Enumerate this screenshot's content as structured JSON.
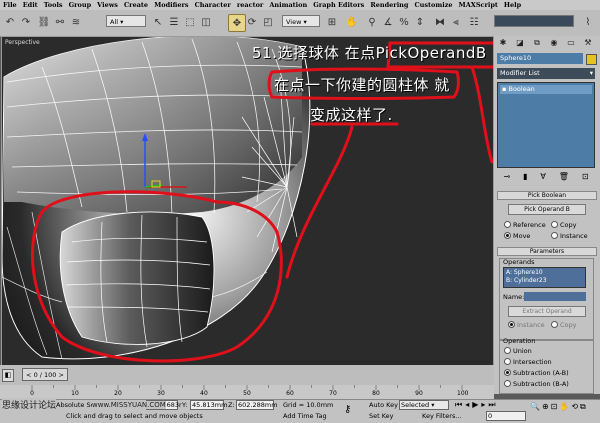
{
  "menu": [
    "File",
    "Edit",
    "Tools",
    "Group",
    "Views",
    "Create",
    "Modifiers",
    "Character",
    "reactor",
    "Animation",
    "Graph Editors",
    "Rendering",
    "Customize",
    "MAXScript",
    "Help"
  ],
  "toolbar": {
    "filter": "All",
    "coord": "View"
  },
  "viewport": {
    "label": "Perspective",
    "annotation": {
      "line1_prefix": "51.选择球体 在点",
      "line1_button": "PickOperandB",
      "line2_prefix": "在点一下你建的圆柱体",
      "line2_suffix": "就",
      "line3": "变成这样了."
    }
  },
  "command_panel": {
    "object_name": "Sphere10",
    "modifier_list": "Modifier List",
    "stack_item": "Boolean",
    "pick_rollout": "Pick Boolean",
    "pick_button": "Pick Operand B",
    "reference": "Reference",
    "copy": "Copy",
    "move": "Move",
    "instance": "Instance",
    "params_rollout": "Parameters",
    "operands_label": "Operands",
    "operands": [
      "A: Sphere10",
      "B: Cylinder23"
    ],
    "name_label": "Name:",
    "extract_button": "Extract Operand",
    "extract_instance": "Instance",
    "extract_copy": "Copy",
    "operation_label": "Operation",
    "operations": [
      "Union",
      "Intersection",
      "Subtraction (A-B)",
      "Subtraction (B-A)"
    ],
    "selected_operation": "Subtraction (A-B)"
  },
  "timeline": {
    "frame": "0 / 100",
    "ticks": [
      "0",
      "10",
      "20",
      "30",
      "40",
      "50",
      "60",
      "70",
      "80",
      "90",
      "100"
    ]
  },
  "status": {
    "lock_label": "Absolute Scale",
    "prompt": "Click and drag to select and move objects",
    "x_label": "X:",
    "x_value": "1251.683r",
    "y_label": "Y:",
    "y_value": "45.813mm",
    "z_label": "Z:",
    "z_value": "602.288mm",
    "grid": "Grid = 10.0mm",
    "add_time_tag": "Add Time Tag",
    "auto_key": "Auto Key",
    "auto_key_mode": "Selected",
    "set_key": "Set Key",
    "key_filters": "Key Filters...",
    "frame_field": "0"
  },
  "watermark": {
    "left": "思缘设计论坛",
    "url": "www.MISSYUAN.COM"
  },
  "colors": {
    "annotation_red": "#e0101a",
    "panel_blue": "#4d7ca6",
    "active_tool": "#e8d58a"
  }
}
